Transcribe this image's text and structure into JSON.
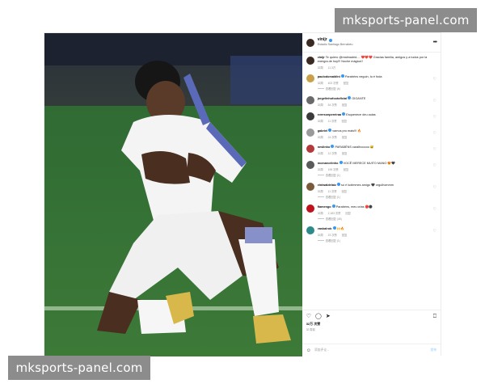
{
  "watermark": {
    "text": "mksports-panel.com"
  },
  "post": {
    "author": "vinijr",
    "location": "Estadio Santiago Bernabéu",
    "caption": {
      "user": "vinijr",
      "text": "Te quiero @realmadrid.... ❤️❤️❤️ Gracias familia, amigos y a todos por la energía de hoy!!! Noche mágica!!",
      "time": "32周",
      "likes": "11.3万"
    },
    "comments": [
      {
        "user": "paulodomaldini",
        "text": "Parabéns neguin, tu é foda",
        "time": "32周",
        "likes": "402 次赞",
        "reply": "回复",
        "view_replies": "查看回复 (6)",
        "avatar_color": "#c9a04a"
      },
      {
        "user": "jorgelinhofootoficial",
        "text": "GIGANTE",
        "time": "32周",
        "likes": "54 次赞",
        "reply": "回复",
        "view_replies": "",
        "avatar_color": "#6a6a6a"
      },
      {
        "user": "eversonpereiraa",
        "text": "Esquenece deu aulas",
        "time": "32周",
        "likes": "11 次赞",
        "reply": "回复",
        "view_replies": "",
        "avatar_color": "#3a3a3a"
      },
      {
        "user": "gabriel",
        "text": "vamos pro mais!!! 🔥",
        "time": "32周",
        "likes": "24 次赞",
        "reply": "回复",
        "view_replies": "",
        "avatar_color": "#9a9a9a"
      },
      {
        "user": "neslinho",
        "text": "PARABÉNS caralhooooo 😅",
        "time": "32周",
        "likes": "12 次赞",
        "reply": "回复",
        "view_replies": "",
        "avatar_color": "#b23a3a"
      },
      {
        "user": "mcmarcelinho",
        "text": "VOCÊ MERECE MUITO MANO 😍🖤",
        "time": "32周",
        "likes": "199 次赞",
        "reply": "回复",
        "view_replies": "查看回复 (1)",
        "avatar_color": "#5a5a5a"
      },
      {
        "user": "viniwaldelaiz",
        "text": "só é ludimmes amigo 🖤 orgulhommm",
        "time": "32周",
        "likes": "11 次赞",
        "reply": "回复",
        "view_replies": "查看回复 (1)",
        "avatar_color": "#7a5a3a"
      },
      {
        "user": "flamengo",
        "text": "Parabéns, meu crias 🔴⚫",
        "time": "32周",
        "likes": "2,183 次赞",
        "reply": "回复",
        "view_replies": "查看回复 (45)",
        "avatar_color": "#c0121c"
      },
      {
        "user": "vaskalrob",
        "text": "🙌🔥",
        "time": "32周",
        "likes": "23 次赞",
        "reply": "回复",
        "view_replies": "查看回复 (1)",
        "avatar_color": "#2c8a8a"
      }
    ],
    "likes_count": "32万 次赞",
    "time_ago": "32 周前",
    "add_comment_placeholder": "添加评论...",
    "post_button": "发布"
  },
  "icons": {
    "more": "more-options-icon",
    "heart": "heart-icon",
    "comment": "comment-icon",
    "share": "share-icon",
    "bookmark": "bookmark-icon",
    "emoji": "emoji-icon"
  },
  "colors": {
    "watermark_bg": "#8c8c8c",
    "verified": "#3897f0",
    "pitch": "#1f4a28",
    "kit_white": "#f2f2f2",
    "boots": "#d8b84a"
  }
}
